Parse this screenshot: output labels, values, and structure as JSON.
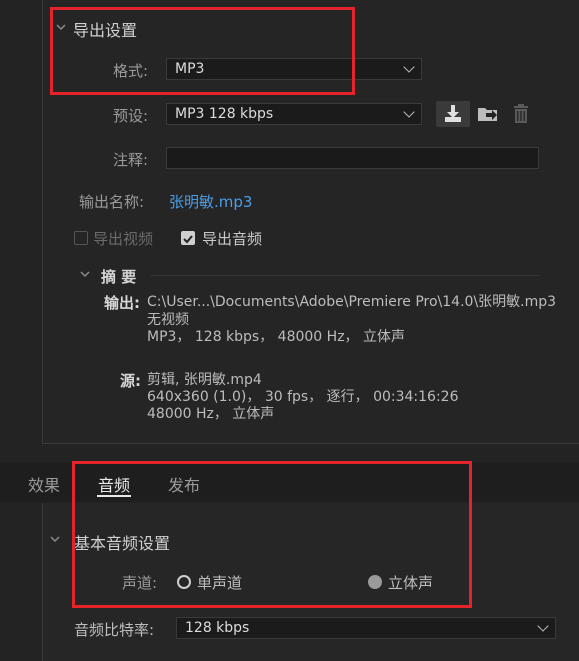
{
  "export_settings": {
    "section_title": "导出设置",
    "format_label": "格式:",
    "format_value": "MP3",
    "preset_label": "预设:",
    "preset_value": "MP3 128 kbps",
    "comment_label": "注释:",
    "comment_value": "",
    "output_name_label": "输出名称:",
    "output_name_value": "张明敏.mp3",
    "export_video_label": "导出视频",
    "export_video_checked": false,
    "export_audio_label": "导出音频",
    "export_audio_checked": true
  },
  "summary": {
    "title": "摘 要",
    "output_label": "输出:",
    "output_lines": [
      "C:\\User...\\Documents\\Adobe\\Premiere  Pro\\14.0\\张明敏.mp3",
      "无视频",
      "MP3， 128 kbps， 48000 Hz， 立体声"
    ],
    "source_label": "源:",
    "source_lines": [
      "剪辑, 张明敏.mp4",
      "640x360 (1.0)， 30 fps， 逐行， 00:34:16:26",
      "48000 Hz， 立体声"
    ]
  },
  "tabs": [
    {
      "label": "效果"
    },
    {
      "label": "音频"
    },
    {
      "label": "发布"
    }
  ],
  "audio": {
    "section_title": "基本音频设置",
    "channel_label": "声道:",
    "mono_label": "单声道",
    "stereo_label": "立体声",
    "selected_channel": "stereo",
    "bitrate_label": "音频比特率:",
    "bitrate_value": "128 kbps"
  },
  "colors": {
    "highlight_box": "#e5232b",
    "link_blue": "#4a9de8",
    "background": "#232323"
  }
}
